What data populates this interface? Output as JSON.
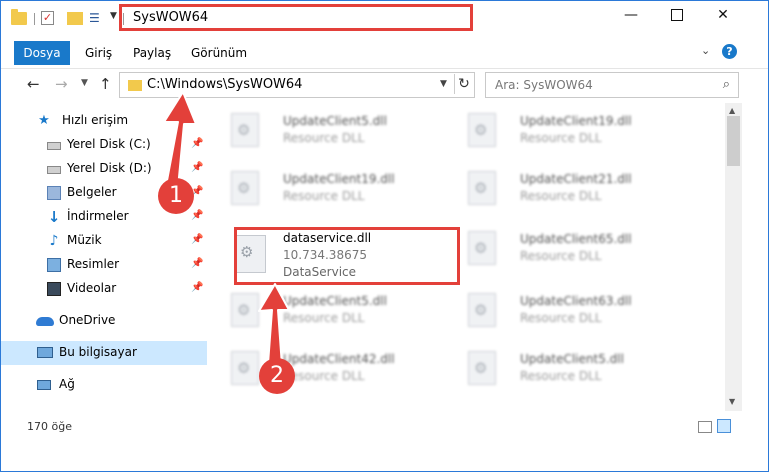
{
  "window": {
    "title": "SysWOW64"
  },
  "ribbon": {
    "tabs": [
      {
        "label": "Dosya"
      },
      {
        "label": "Giriş"
      },
      {
        "label": "Paylaş"
      },
      {
        "label": "Görünüm"
      }
    ]
  },
  "nav": {
    "address": "C:\\Windows\\SysWOW64",
    "search_placeholder": "Ara: SysWOW64"
  },
  "sidebar": {
    "items": [
      {
        "label": "Hızlı erişim",
        "icon": "star-icon"
      },
      {
        "label": "Yerel Disk (C:)",
        "icon": "drive-icon",
        "pinned": true
      },
      {
        "label": "Yerel Disk (D:)",
        "icon": "drive-icon",
        "pinned": true
      },
      {
        "label": "Belgeler",
        "icon": "documents-icon",
        "pinned": true
      },
      {
        "label": "İndirmeler",
        "icon": "download-icon",
        "pinned": true
      },
      {
        "label": "Müzik",
        "icon": "music-icon",
        "pinned": true
      },
      {
        "label": "Resimler",
        "icon": "pictures-icon",
        "pinned": true
      },
      {
        "label": "Videolar",
        "icon": "videos-icon",
        "pinned": true
      },
      {
        "label": "OneDrive",
        "icon": "onedrive-icon"
      },
      {
        "label": "Bu bilgisayar",
        "icon": "pc-icon",
        "selected": true
      },
      {
        "label": "Ağ",
        "icon": "network-icon"
      }
    ]
  },
  "files": {
    "left": [
      {
        "name": "UpdateClient5.dll",
        "type": "Resource DLL"
      },
      {
        "name": "UpdateClient19.dll",
        "type": "Resource DLL"
      },
      {
        "name": "dataservice.dll",
        "version": "10.734.38675",
        "type": "DataService"
      },
      {
        "name": "UpdateClient5.dll",
        "type": "Resource DLL"
      },
      {
        "name": "UpdateClient42.dll",
        "type": "Resource DLL"
      }
    ],
    "right": [
      {
        "name": "UpdateClient19.dll",
        "type": "Resource DLL"
      },
      {
        "name": "UpdateClient21.dll",
        "type": "Resource DLL"
      },
      {
        "name": "UpdateClient65.dll",
        "type": "Resource DLL"
      },
      {
        "name": "UpdateClient63.dll",
        "type": "Resource DLL"
      },
      {
        "name": "UpdateClient5.dll",
        "type": "Resource DLL"
      }
    ]
  },
  "status": {
    "item_count": "170 öğe"
  },
  "callouts": {
    "one": "1",
    "two": "2"
  },
  "colors": {
    "accent": "#1979ca",
    "highlight": "#e3403a",
    "selection": "#cce8ff",
    "folder": "#f2c94c"
  }
}
